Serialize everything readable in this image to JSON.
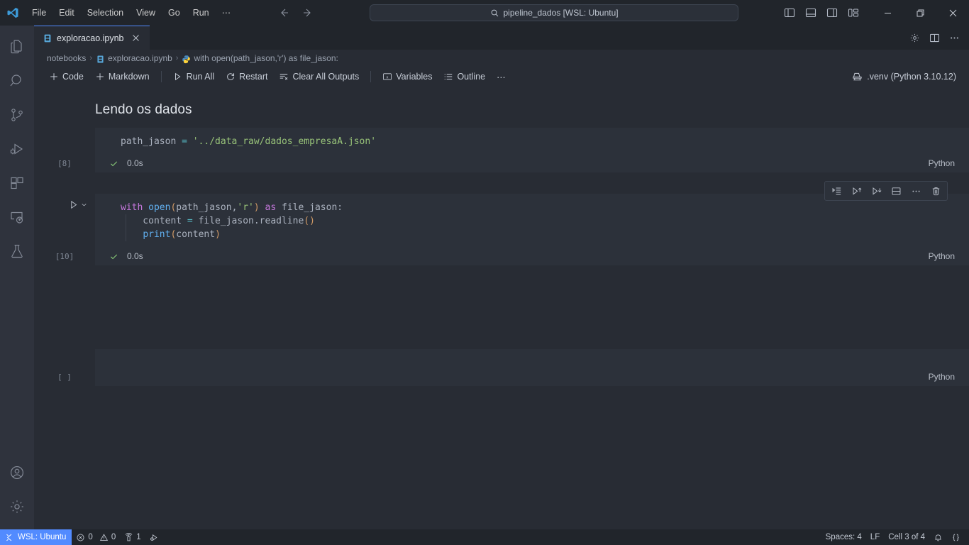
{
  "titlebar": {
    "menu": [
      "File",
      "Edit",
      "Selection",
      "View",
      "Go",
      "Run"
    ],
    "menu_overflow": "⋯",
    "quick_input": "pipeline_dados [WSL: Ubuntu]",
    "search_icon": "search-icon",
    "back_icon": "arrow-left-icon",
    "forward_icon": "arrow-right-icon",
    "layout_icons": [
      "toggle-primary-sidebar-icon",
      "toggle-panel-icon",
      "toggle-secondary-sidebar-icon",
      "customize-layout-icon"
    ],
    "window_controls": [
      "minimize",
      "restore",
      "close"
    ]
  },
  "activitybar": {
    "items": [
      {
        "name": "explorer",
        "label": "Explorer",
        "active": false
      },
      {
        "name": "search",
        "label": "Search",
        "active": false
      },
      {
        "name": "source-control",
        "label": "Source Control",
        "active": false
      },
      {
        "name": "run-and-debug",
        "label": "Run and Debug",
        "active": false
      },
      {
        "name": "extensions",
        "label": "Extensions",
        "active": false
      },
      {
        "name": "remote-explorer",
        "label": "Remote Explorer",
        "active": false
      },
      {
        "name": "testing",
        "label": "Testing",
        "active": false
      }
    ],
    "bottom": [
      {
        "name": "accounts",
        "label": "Accounts"
      },
      {
        "name": "manage",
        "label": "Manage"
      }
    ]
  },
  "tab": {
    "label": "exploracao.ipynb",
    "icon": "notebook-icon",
    "close_icon": "close-icon",
    "actions": [
      "settings-gear-icon",
      "split-editor-icon",
      "more-actions-icon"
    ]
  },
  "breadcrumb": {
    "segments": [
      {
        "label": "notebooks",
        "icon": null
      },
      {
        "label": "exploracao.ipynb",
        "icon": "notebook-icon"
      },
      {
        "label": "with open(path_jason,'r') as file_jason:",
        "icon": "python-icon"
      }
    ],
    "separator": "›"
  },
  "notebook_toolbar": {
    "buttons": [
      {
        "label": "Code",
        "icon": "plus-icon"
      },
      {
        "label": "Markdown",
        "icon": "plus-icon"
      },
      {
        "label": "Run All",
        "icon": "run-all-icon"
      },
      {
        "label": "Restart",
        "icon": "restart-icon"
      },
      {
        "label": "Clear All Outputs",
        "icon": "clear-outputs-icon"
      },
      {
        "label": "Variables",
        "icon": "variables-icon"
      },
      {
        "label": "Outline",
        "icon": "outline-icon"
      }
    ],
    "more": "⋯",
    "kernel": {
      "label": ".venv (Python 3.10.12)",
      "icon": "kernel-icon"
    }
  },
  "notebook": {
    "markdown_heading": "Lendo os dados",
    "cells": [
      {
        "type": "code",
        "exec_count": "[8]",
        "status_icon": "check-icon",
        "elapsed": "0.0s",
        "language": "Python",
        "lines": [
          [
            {
              "t": "path_jason ",
              "c": "plain"
            },
            {
              "t": "= ",
              "c": "operator"
            },
            {
              "t": "'../data_raw/dados_empresaA.json'",
              "c": "string"
            }
          ]
        ]
      },
      {
        "type": "code",
        "exec_count": "[10]",
        "status_icon": "check-icon",
        "elapsed": "0.0s",
        "language": "Python",
        "has_run_button": true,
        "has_hover_toolbar": true,
        "output_ellipsis": "···",
        "lines": [
          [
            {
              "t": "with ",
              "c": "keyword"
            },
            {
              "t": "open",
              "c": "function"
            },
            {
              "t": "(",
              "c": "paren1"
            },
            {
              "t": "path_jason",
              "c": "plain"
            },
            {
              "t": ",",
              "c": "plain"
            },
            {
              "t": "'r'",
              "c": "string"
            },
            {
              "t": ")",
              "c": "paren1"
            },
            {
              "t": " as ",
              "c": "keyword"
            },
            {
              "t": "file_jason:",
              "c": "plain"
            }
          ],
          [
            {
              "t": "    content ",
              "c": "plain"
            },
            {
              "t": "= ",
              "c": "operator"
            },
            {
              "t": "file_jason.readline",
              "c": "plain"
            },
            {
              "t": "()",
              "c": "paren1"
            }
          ],
          [
            {
              "t": "    ",
              "c": "plain"
            },
            {
              "t": "print",
              "c": "function"
            },
            {
              "t": "(",
              "c": "paren1"
            },
            {
              "t": "content",
              "c": "plain"
            },
            {
              "t": ")",
              "c": "paren1"
            }
          ]
        ]
      },
      {
        "type": "code",
        "exec_count": "[ ]",
        "language": "Python",
        "empty": true,
        "lines": []
      }
    ],
    "cell_toolbar_icons": [
      "execute-above-icon",
      "run-above-icon",
      "run-below-icon",
      "split-cell-icon",
      "more-actions-icon",
      "delete-cell-icon"
    ]
  },
  "statusbar": {
    "remote": {
      "label": "WSL: Ubuntu",
      "icon": "remote-icon"
    },
    "problems": {
      "errors": "0",
      "warnings": "0",
      "error_icon": "error-icon",
      "warning_icon": "warning-icon"
    },
    "ports": {
      "count": "1",
      "icon": "ports-icon"
    },
    "debug": {
      "icon": "run-debug-icon"
    },
    "right": [
      {
        "name": "indentation",
        "label": "Spaces: 4"
      },
      {
        "name": "eol",
        "label": "LF"
      },
      {
        "name": "cell-position",
        "label": "Cell 3 of 4"
      },
      {
        "name": "notifications",
        "label": "",
        "icon": "bell-icon"
      },
      {
        "name": "remote-tunnel",
        "label": "",
        "icon": "braces-icon"
      }
    ]
  },
  "colors": {
    "accent": "#528bff",
    "editor_bg": "#282c34",
    "cell_bg": "#2c313a",
    "chrome_bg": "#21252b",
    "activitybar_bg": "#2f333d",
    "keyword": "#c678dd",
    "function": "#61afef",
    "string": "#98c379",
    "operator": "#56b6c2",
    "paren": "#d19a66",
    "success": "#89ca78"
  }
}
